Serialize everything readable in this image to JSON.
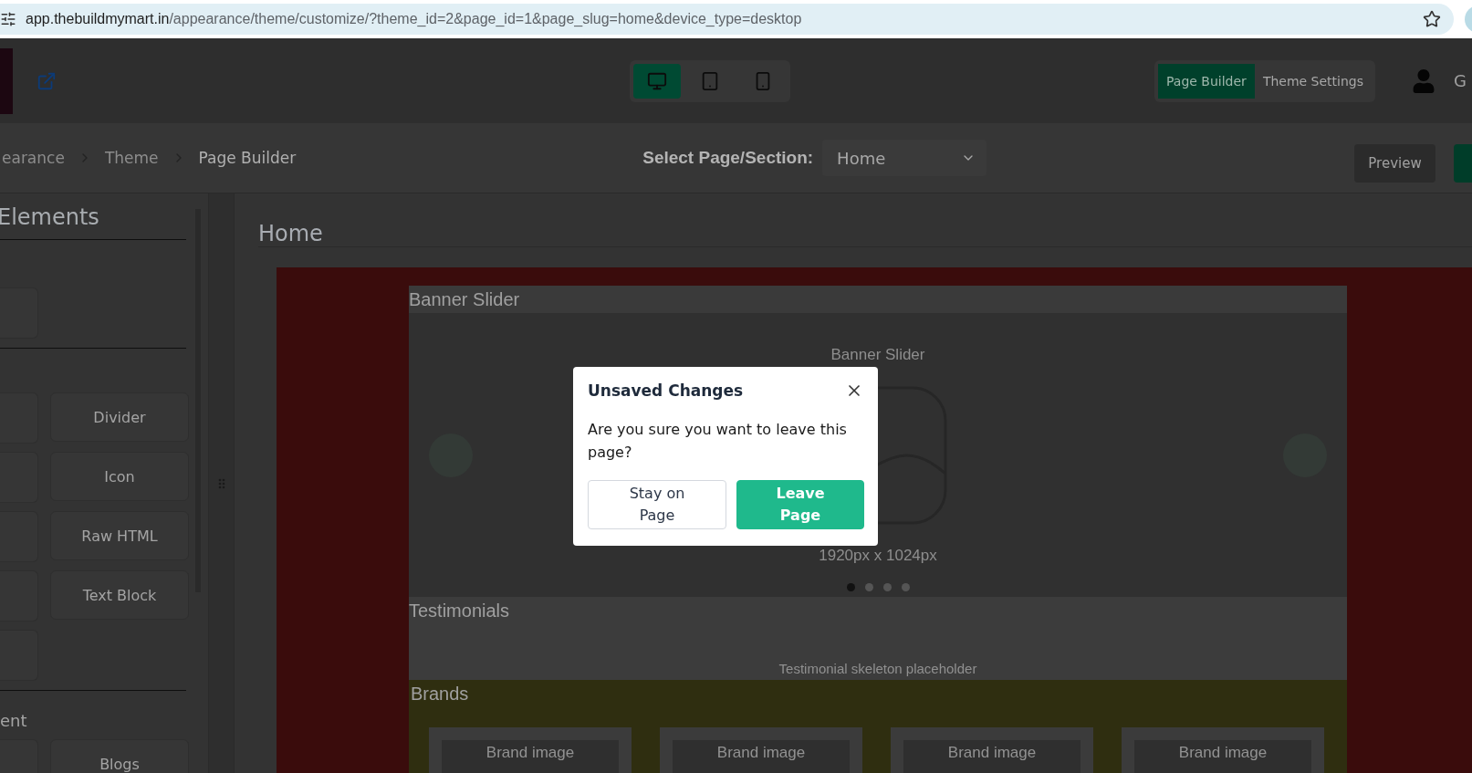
{
  "browser": {
    "host": "app.thebuildmymart.in",
    "path": "/appearance/theme/customize/?theme_id=2&page_id=1&page_slug=home&device_type=desktop"
  },
  "header": {
    "devices": [
      {
        "kind": "desktop",
        "selected": true
      },
      {
        "kind": "tablet",
        "selected": false
      },
      {
        "kind": "mobile",
        "selected": false
      }
    ],
    "modes": [
      {
        "label": "Page Builder",
        "selected": true
      },
      {
        "label": "Theme Settings",
        "selected": false
      }
    ],
    "user_initial": "G"
  },
  "breadcrumbs": [
    "earance",
    "Theme",
    "Page Builder"
  ],
  "page_select": {
    "label": "Select Page/Section:",
    "value": "Home"
  },
  "actions": [
    {
      "kind": "secondary",
      "label": "Preview"
    },
    {
      "kind": "primary"
    }
  ],
  "sidebar": {
    "title": "Elements",
    "groups": [
      {
        "cards": [
          {
            "kind": "stub"
          }
        ]
      },
      {
        "cards": [
          {
            "kind": "stub"
          },
          {
            "kind": "card",
            "label": "Divider"
          },
          {
            "kind": "stub"
          },
          {
            "kind": "card",
            "label": "Icon"
          },
          {
            "kind": "stub"
          },
          {
            "kind": "card",
            "label": "Raw HTML"
          },
          {
            "kind": "stub"
          },
          {
            "kind": "card",
            "label": "Text Block"
          },
          {
            "kind": "stub"
          }
        ]
      },
      {
        "heading": "ent",
        "cards": [
          {
            "kind": "stub"
          },
          {
            "kind": "card",
            "label": "Blogs"
          }
        ]
      }
    ]
  },
  "canvas": {
    "title": "Home",
    "sections": [
      {
        "kind": "banner",
        "title": "Banner Slider",
        "caption": "Banner Slider",
        "size": "1920px x 1024px",
        "dots": [
          {
            "selected": true
          },
          {
            "selected": false
          },
          {
            "selected": false
          },
          {
            "selected": false
          }
        ]
      },
      {
        "kind": "testimonials",
        "title": "Testimonials",
        "placeholder": "Testimonial skeleton placeholder"
      },
      {
        "kind": "brands",
        "title": "Brands",
        "items": [
          "Brand image",
          "Brand image",
          "Brand image",
          "Brand image"
        ]
      }
    ]
  },
  "dialog": {
    "title": "Unsaved Changes",
    "message": "Are you sure you want to leave this page?",
    "buttons": [
      {
        "kind": "secondary",
        "label": "Stay on Page"
      },
      {
        "kind": "primary",
        "label": "Leave Page"
      }
    ]
  }
}
